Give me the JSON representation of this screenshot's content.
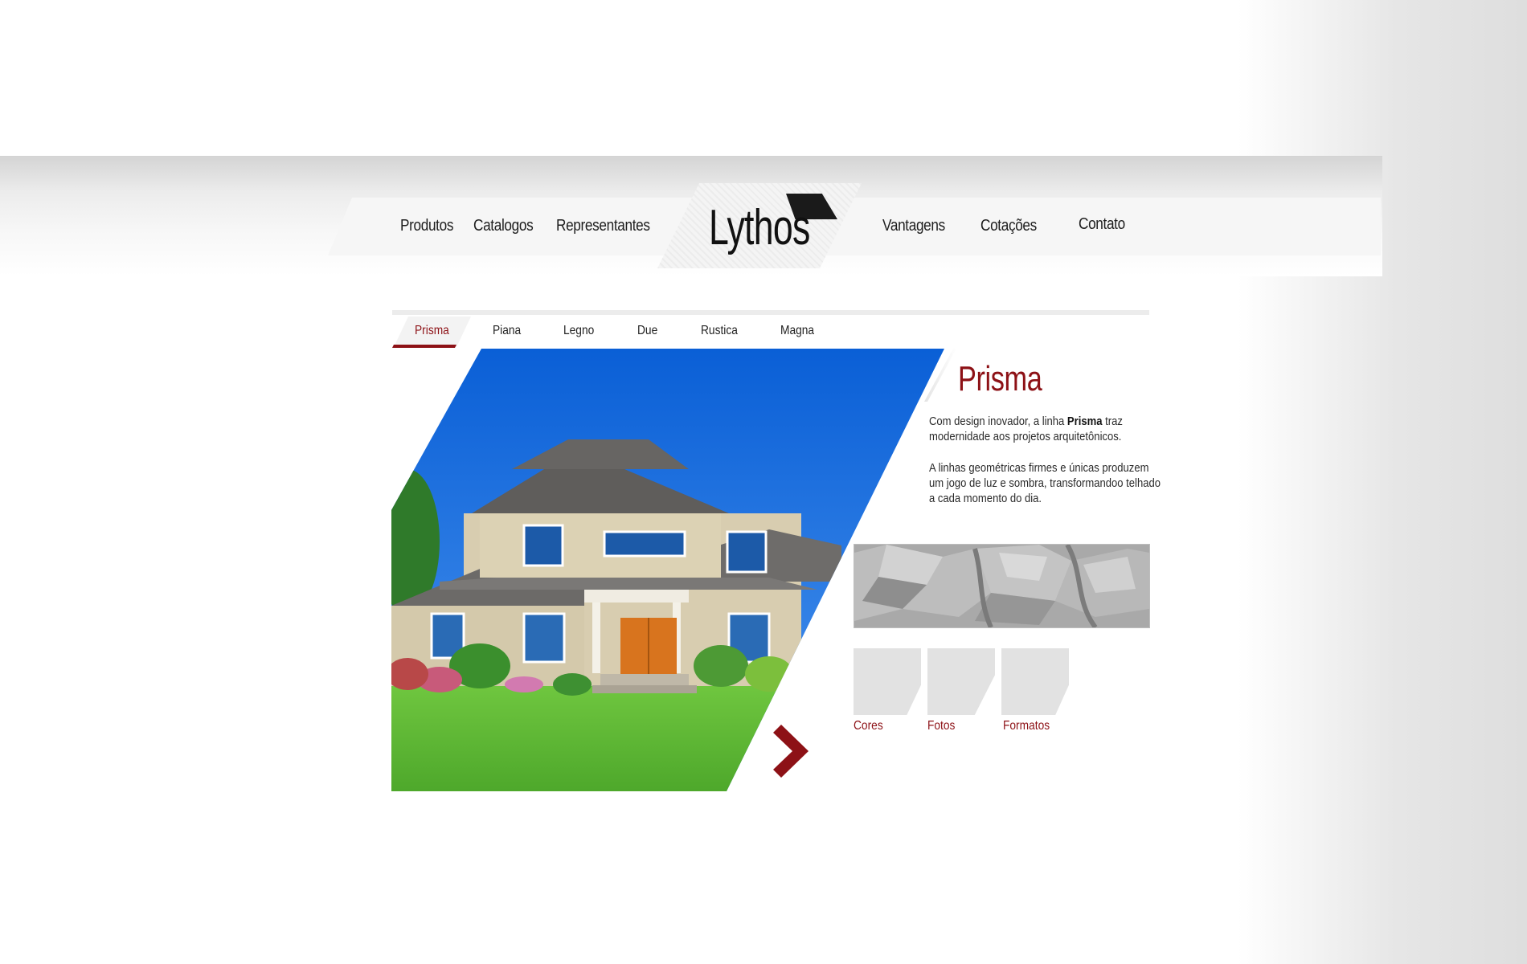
{
  "brand": {
    "logo_text": "Lythos"
  },
  "nav": {
    "left": [
      "Produtos",
      "Catalogos",
      "Representantes"
    ],
    "right": [
      "Vantagens",
      "Cotações",
      "Contato"
    ]
  },
  "tabs": {
    "items": [
      "Prisma",
      "Piana",
      "Legno",
      "Due",
      "Rustica",
      "Magna"
    ],
    "active": "Prisma"
  },
  "product": {
    "title": "Prisma",
    "desc1_before": "Com design inovador, a linha ",
    "desc1_bold": "Prisma",
    "desc1_after": " traz modernidade aos projetos arquitetônicos.",
    "desc2": "A linhas geométricas firmes e únicas produzem um jogo de luz e sombra, transformandoo telhado a cada momento do dia."
  },
  "options": [
    "Cores",
    "Fotos",
    "Formatos"
  ],
  "colors": {
    "accent": "#8d1116",
    "sky": "#1a6fe0",
    "grass": "#6cc23d",
    "thumb": "#e2e2e2"
  },
  "icons": {
    "next": "chevron-right-icon"
  }
}
